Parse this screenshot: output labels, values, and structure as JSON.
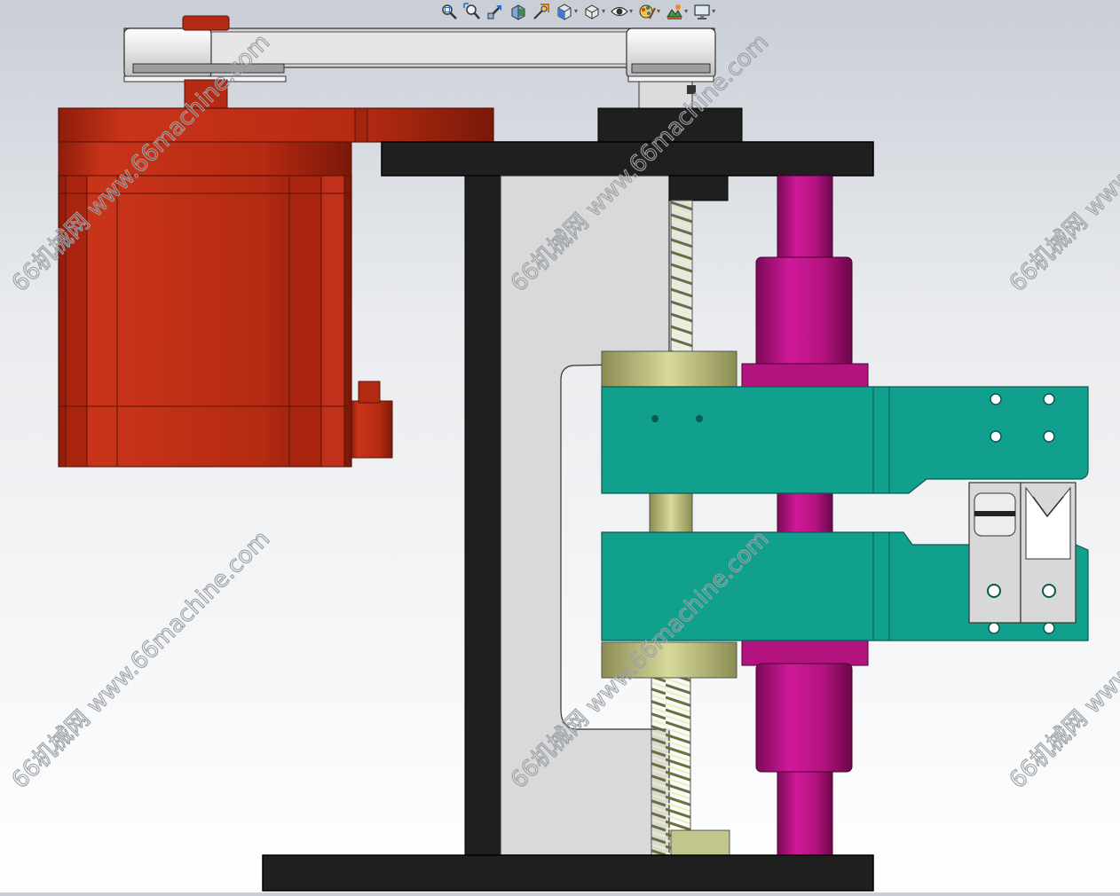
{
  "toolbar": {
    "buttons": [
      {
        "icon": "zoom-to-fit-icon",
        "dropdown": false
      },
      {
        "icon": "zoom-to-area-icon",
        "dropdown": false
      },
      {
        "icon": "previous-view-icon",
        "dropdown": false
      },
      {
        "icon": "section-view-icon",
        "dropdown": false
      },
      {
        "icon": "dynamic-annotation-icon",
        "dropdown": false
      },
      {
        "icon": "view-orientation-icon",
        "dropdown": true
      },
      {
        "icon": "display-style-icon",
        "dropdown": true
      },
      {
        "icon": "hide-show-items-icon",
        "dropdown": true
      },
      {
        "icon": "edit-appearance-icon",
        "dropdown": true
      },
      {
        "icon": "apply-scene-icon",
        "dropdown": true
      },
      {
        "icon": "view-settings-icon",
        "dropdown": true
      }
    ],
    "dropdown_glyph": "▾"
  },
  "watermark": {
    "text": "66机械网 www.66machine.com",
    "color": "#9aa0a6"
  },
  "colors": {
    "motor": "#b52a12",
    "frame": "#1f1f1f",
    "plate": "#d9d9d9",
    "screw": "#c3c68c",
    "rod": "#b3137f",
    "jaw": "#12a08e",
    "pulley": "#e4e4e4"
  }
}
